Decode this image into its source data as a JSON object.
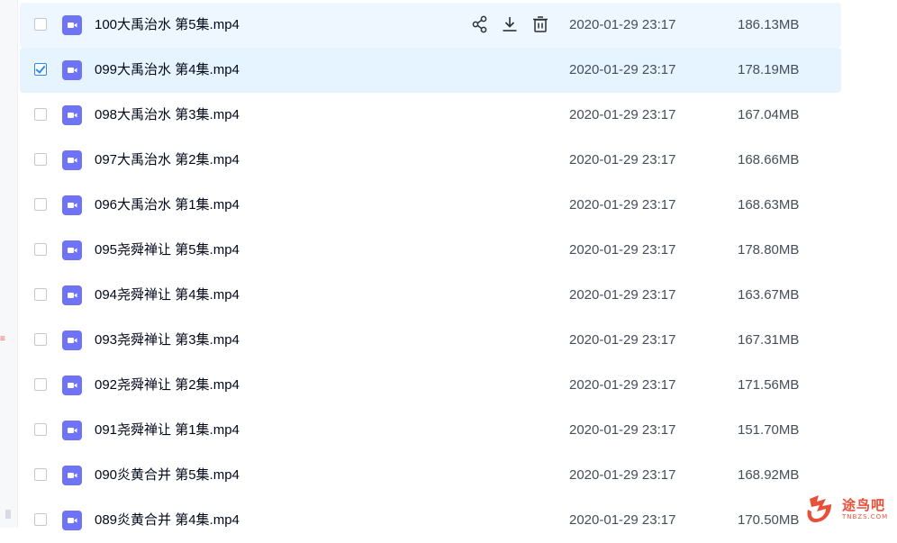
{
  "files": [
    {
      "name": "100大禹治水 第5集.mp4",
      "date": "2020-01-29 23:17",
      "size": "186.13MB",
      "checked": false,
      "state": "hover"
    },
    {
      "name": "099大禹治水 第4集.mp4",
      "date": "2020-01-29 23:17",
      "size": "178.19MB",
      "checked": true,
      "state": "selected"
    },
    {
      "name": "098大禹治水 第3集.mp4",
      "date": "2020-01-29 23:17",
      "size": "167.04MB",
      "checked": false,
      "state": ""
    },
    {
      "name": "097大禹治水 第2集.mp4",
      "date": "2020-01-29 23:17",
      "size": "168.66MB",
      "checked": false,
      "state": ""
    },
    {
      "name": "096大禹治水 第1集.mp4",
      "date": "2020-01-29 23:17",
      "size": "168.63MB",
      "checked": false,
      "state": ""
    },
    {
      "name": "095尧舜禅让 第5集.mp4",
      "date": "2020-01-29 23:17",
      "size": "178.80MB",
      "checked": false,
      "state": ""
    },
    {
      "name": "094尧舜禅让 第4集.mp4",
      "date": "2020-01-29 23:17",
      "size": "163.67MB",
      "checked": false,
      "state": ""
    },
    {
      "name": "093尧舜禅让 第3集.mp4",
      "date": "2020-01-29 23:17",
      "size": "167.31MB",
      "checked": false,
      "state": ""
    },
    {
      "name": "092尧舜禅让 第2集.mp4",
      "date": "2020-01-29 23:17",
      "size": "171.56MB",
      "checked": false,
      "state": ""
    },
    {
      "name": "091尧舜禅让 第1集.mp4",
      "date": "2020-01-29 23:17",
      "size": "151.70MB",
      "checked": false,
      "state": ""
    },
    {
      "name": "090炎黄合并 第5集.mp4",
      "date": "2020-01-29 23:17",
      "size": "168.92MB",
      "checked": false,
      "state": ""
    },
    {
      "name": "089炎黄合并 第4集.mp4",
      "date": "2020-01-29 23:17",
      "size": "170.50MB",
      "checked": false,
      "state": ""
    }
  ],
  "row_actions": [
    {
      "icon": "share-icon"
    },
    {
      "icon": "download-icon"
    },
    {
      "icon": "delete-icon"
    }
  ],
  "file_icon": "video-file-icon",
  "colors": {
    "accent": "#2f86f6",
    "file_icon": "#6f73f5",
    "hover_bg": "#eef7ff",
    "selected_bg": "#e6f4ff",
    "watermark": "#e8503a"
  },
  "watermark": {
    "main": "途鸟吧",
    "sub": "TNBZS.COM"
  }
}
